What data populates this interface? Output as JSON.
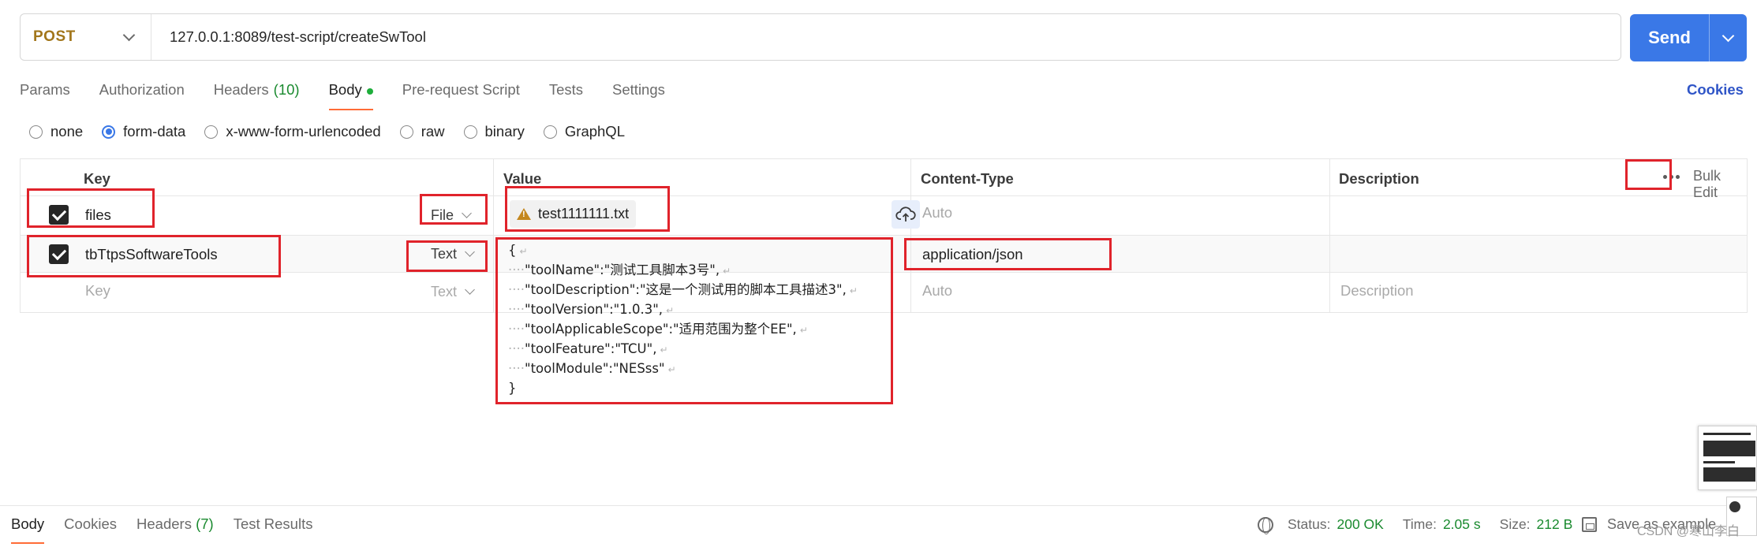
{
  "request": {
    "method": "POST",
    "url": "127.0.0.1:8089/test-script/createSwTool",
    "send_label": "Send"
  },
  "tabs": [
    {
      "label": "Params"
    },
    {
      "label": "Authorization"
    },
    {
      "label": "Headers",
      "count": "(10)"
    },
    {
      "label": "Body",
      "active": true
    },
    {
      "label": "Pre-request Script"
    },
    {
      "label": "Tests"
    },
    {
      "label": "Settings"
    }
  ],
  "cookies_label": "Cookies",
  "body_types": [
    {
      "label": "none",
      "checked": false
    },
    {
      "label": "form-data",
      "checked": true
    },
    {
      "label": "x-www-form-urlencoded",
      "checked": false
    },
    {
      "label": "raw",
      "checked": false
    },
    {
      "label": "binary",
      "checked": false
    },
    {
      "label": "GraphQL",
      "checked": false
    }
  ],
  "table": {
    "headers": {
      "key": "Key",
      "value": "Value",
      "content_type": "Content-Type",
      "description": "Description",
      "bulk_edit": "Bulk Edit"
    },
    "rows": [
      {
        "key": "files",
        "type": "File",
        "value": "test1111111.txt",
        "content_type": "Auto"
      },
      {
        "key": "tbTtpsSoftwareTools",
        "type": "Text",
        "value_lines": [
          "{",
          "\"toolName\":\"测试工具脚本3号\",",
          "\"toolDescription\":\"这是一个测试用的脚本工具描述3\",",
          "\"toolVersion\":\"1.0.3\",",
          "\"toolApplicableScope\":\"适用范围为整个EE\",",
          "\"toolFeature\":\"TCU\",",
          "\"toolModule\":\"NESss\"",
          "}"
        ],
        "content_type": "application/json"
      },
      {
        "key_placeholder": "Key",
        "type": "Text",
        "content_type_placeholder": "Auto",
        "description_placeholder": "Description"
      }
    ]
  },
  "bottom": {
    "tabs": [
      {
        "label": "Body",
        "active": true
      },
      {
        "label": "Cookies"
      },
      {
        "label": "Headers",
        "count": "(7)"
      },
      {
        "label": "Test Results"
      }
    ],
    "status_label": "Status:",
    "status_value": "200 OK",
    "time_label": "Time:",
    "time_value": "2.05 s",
    "size_label": "Size:",
    "size_value": "212 B",
    "save_example": "Save as example"
  },
  "watermark": "CSDN @寒山李白",
  "colors": {
    "accent": "#3a78e7",
    "method": "#a2761b",
    "tab_underline": "#ff6c37",
    "success": "#1a8a2f",
    "annotation": "#e0232b"
  }
}
